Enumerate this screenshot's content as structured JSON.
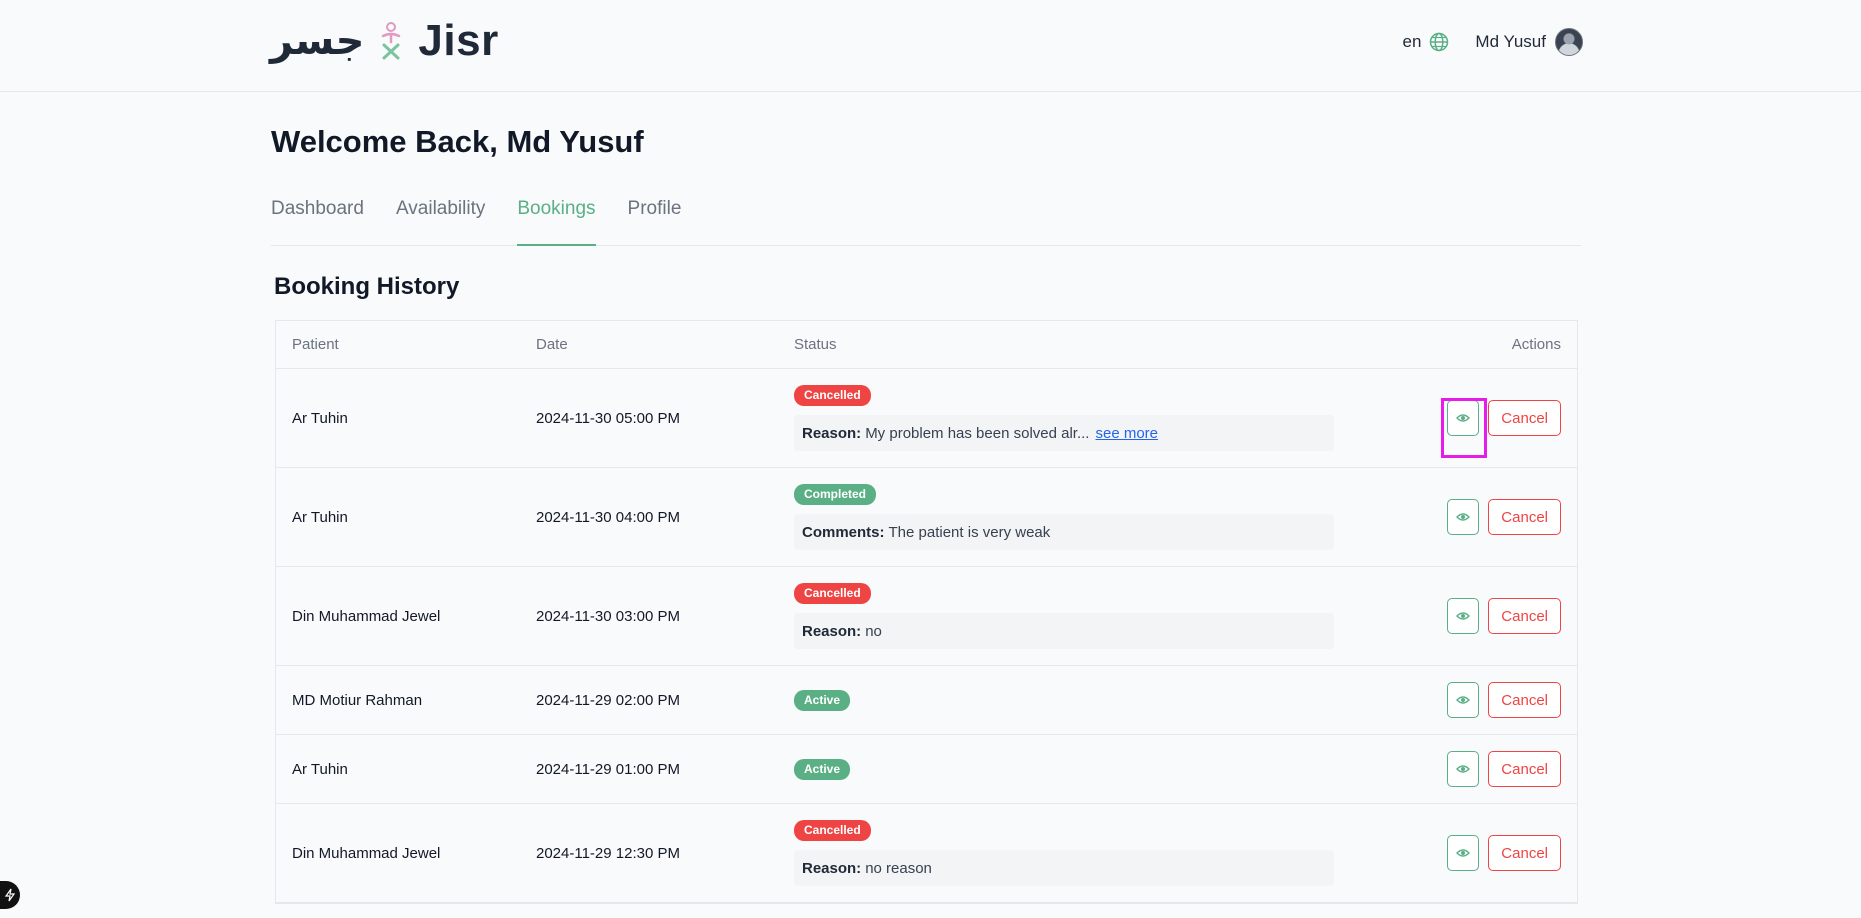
{
  "header": {
    "brand_arabic": "جسر",
    "brand_name": "Jisr",
    "language": "en",
    "user_name": "Md Yusuf"
  },
  "welcome": "Welcome Back, Md Yusuf",
  "tabs": [
    {
      "label": "Dashboard",
      "active": false
    },
    {
      "label": "Availability",
      "active": false
    },
    {
      "label": "Bookings",
      "active": true
    },
    {
      "label": "Profile",
      "active": false
    }
  ],
  "section_title": "Booking History",
  "table": {
    "headers": {
      "patient": "Patient",
      "date": "Date",
      "status": "Status",
      "actions": "Actions"
    },
    "rows": [
      {
        "patient": "Ar Tuhin",
        "date": "2024-11-30 05:00 PM",
        "status": "Cancelled",
        "note_label": "Reason:",
        "note_text": "My problem has been solved alr...",
        "see_more": "see more",
        "cancel": "Cancel"
      },
      {
        "patient": "Ar Tuhin",
        "date": "2024-11-30 04:00 PM",
        "status": "Completed",
        "note_label": "Comments:",
        "note_text": "The patient is very weak",
        "cancel": "Cancel"
      },
      {
        "patient": "Din Muhammad Jewel",
        "date": "2024-11-30 03:00 PM",
        "status": "Cancelled",
        "note_label": "Reason:",
        "note_text": "no",
        "cancel": "Cancel"
      },
      {
        "patient": "MD Motiur Rahman",
        "date": "2024-11-29 02:00 PM",
        "status": "Active",
        "cancel": "Cancel"
      },
      {
        "patient": "Ar Tuhin",
        "date": "2024-11-29 01:00 PM",
        "status": "Active",
        "cancel": "Cancel"
      },
      {
        "patient": "Din Muhammad Jewel",
        "date": "2024-11-29 12:30 PM",
        "status": "Cancelled",
        "note_label": "Reason:",
        "note_text": "no reason",
        "cancel": "Cancel"
      }
    ]
  },
  "colors": {
    "accent": "#5aaf84",
    "danger": "#ef4444",
    "highlight": "#e81ce8"
  },
  "icons": {
    "language": "globe-icon",
    "view": "eye-icon"
  }
}
